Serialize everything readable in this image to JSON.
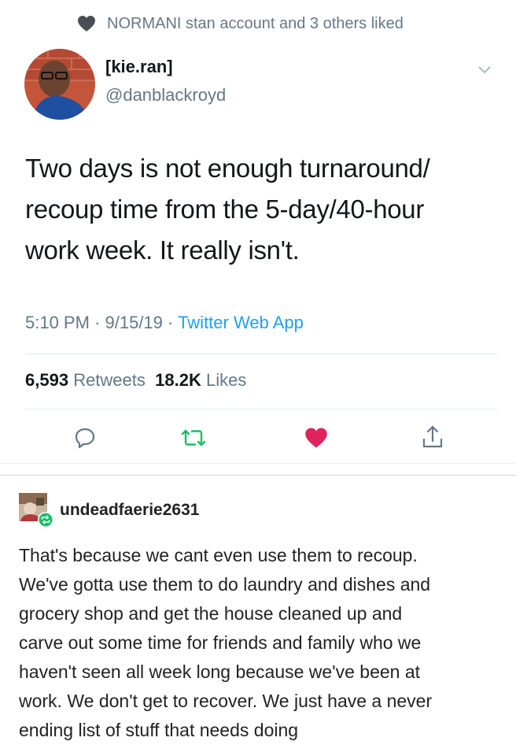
{
  "social_context": {
    "text": "NORMANI stan account and 3 others liked",
    "icon": "heart-icon"
  },
  "tweet": {
    "author_name": "[kie.ran]",
    "author_handle": "@danblackroyd",
    "text_lines": [
      "Two days is not enough turnaround/",
      "recoup time from the 5-day/40-hour",
      "work week. It really isn't."
    ],
    "time": "5:10 PM",
    "date": "9/15/19",
    "source": "Twitter Web App",
    "retweet_count": "6,593",
    "retweet_label": "Retweets",
    "like_count": "18.2K",
    "like_label": "Likes",
    "liked": true
  },
  "colors": {
    "accent": "#1da1f2",
    "like": "#e0245e",
    "retweet": "#17bf63",
    "secondary_text": "#657786"
  },
  "reply": {
    "username": "undeadfaerie2631",
    "text_lines": [
      "That's because we cant even use them to recoup.",
      "We've gotta use them to do laundry and dishes and",
      "grocery shop and get the house cleaned up and",
      "carve out some time for friends and family who we",
      "haven't seen all week long because we've been at",
      "work. We don't get to recover. We just have a never",
      "ending list of stuff that needs doing"
    ]
  }
}
